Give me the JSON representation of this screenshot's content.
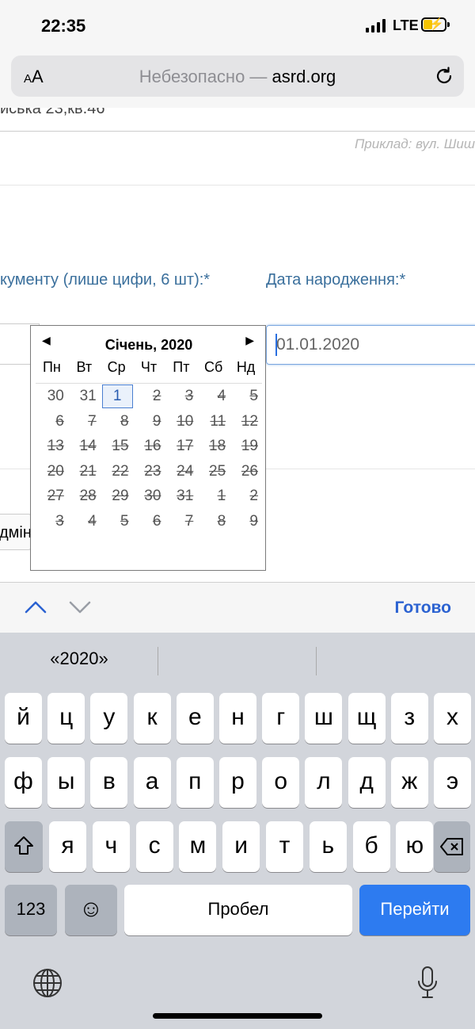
{
  "status": {
    "time": "22:35",
    "network": "LTE"
  },
  "browser": {
    "aa_small": "A",
    "aa_big": "A",
    "insecure": "Небезопасно — ",
    "domain": "asrd.org"
  },
  "form": {
    "address_value": "иська 23,кв.46",
    "address_hint": "Приклад: вул. Шиш",
    "doc_label": "кументу (лише цифи, 6 шт):*",
    "dob_label": "Дата народження:*",
    "dob_value": "01.01.2020",
    "partial_button": "дмін"
  },
  "calendar": {
    "title": "Січень, 2020",
    "weekdays": [
      "Пн",
      "Вт",
      "Ср",
      "Чт",
      "Пт",
      "Сб",
      "Нд"
    ],
    "days": [
      [
        "30",
        "31",
        "1",
        "2",
        "3",
        "4",
        "5"
      ],
      [
        "6",
        "7",
        "8",
        "9",
        "10",
        "11",
        "12"
      ],
      [
        "13",
        "14",
        "15",
        "16",
        "17",
        "18",
        "19"
      ],
      [
        "20",
        "21",
        "22",
        "23",
        "24",
        "25",
        "26"
      ],
      [
        "27",
        "28",
        "29",
        "30",
        "31",
        "1",
        "2"
      ],
      [
        "3",
        "4",
        "5",
        "6",
        "7",
        "8",
        "9"
      ]
    ],
    "selected_day": "1"
  },
  "toolbar": {
    "done_label": "Готово"
  },
  "keyboard": {
    "suggestion": "«2020»",
    "row1": [
      "й",
      "ц",
      "у",
      "к",
      "е",
      "н",
      "г",
      "ш",
      "щ",
      "з",
      "х"
    ],
    "row2": [
      "ф",
      "ы",
      "в",
      "а",
      "п",
      "р",
      "о",
      "л",
      "д",
      "ж",
      "э"
    ],
    "row3": [
      "я",
      "ч",
      "с",
      "м",
      "и",
      "т",
      "ь",
      "б",
      "ю"
    ],
    "numbers_label": "123",
    "emoji": "☺",
    "space_label": "Пробел",
    "go_label": "Перейти"
  }
}
